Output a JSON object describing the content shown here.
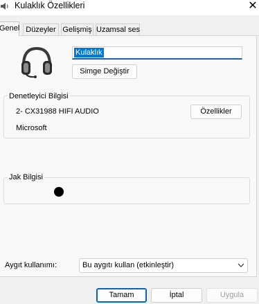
{
  "window": {
    "title": "Kulaklık Özellikleri",
    "close_glyph": "✕"
  },
  "tabs": [
    {
      "label": "Genel",
      "active": true
    },
    {
      "label": "Düzeyler",
      "active": false
    },
    {
      "label": "Gelişmiş",
      "active": false
    },
    {
      "label": "Uzamsal ses",
      "active": false
    }
  ],
  "general": {
    "device_icon": "headset-icon",
    "device_name_value": "Kulaklık",
    "change_icon_label": "Simge Değiştir"
  },
  "controller": {
    "group_title": "Denetleyici Bilgisi",
    "device_model": "2- CX31988 HIFI AUDIO",
    "manufacturer": "Microsoft",
    "properties_label": "Özellikler"
  },
  "jack": {
    "group_title": "Jak Bilgisi"
  },
  "usage": {
    "label": "Aygıt kullanımı:",
    "selected": "Bu aygıtı kullan (etkinleştir)"
  },
  "buttons": {
    "ok": "Tamam",
    "cancel": "İptal",
    "apply": "Uygula"
  },
  "colors": {
    "accent": "#0078d7",
    "primary_border": "#005fb8"
  }
}
